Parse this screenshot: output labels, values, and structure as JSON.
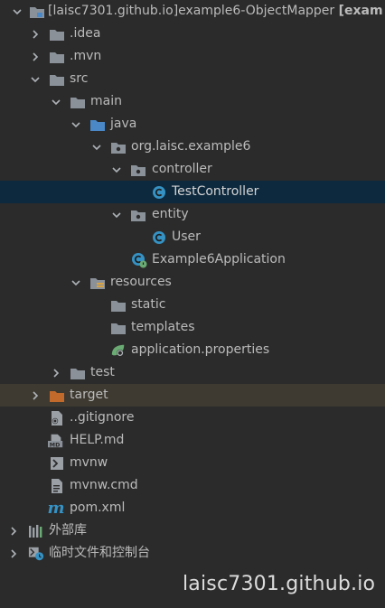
{
  "tree": {
    "root": {
      "label_prefix": "[laisc7301.github.io]example6-ObjectMapper ",
      "label_bold": "[exam"
    },
    "idea": "idea",
    "mvn": "mvn",
    "src": "src",
    "main": "main",
    "java": "java",
    "package": "org.laisc.example6",
    "controller": "controller",
    "test_controller": "TestController",
    "entity": "entity",
    "user": "User",
    "app": "Example6Application",
    "resources": "resources",
    "static": "static",
    "templates": "templates",
    "app_props": "application.properties",
    "test": "test",
    "target": "target",
    "gitignore": ".gitignore",
    "help_md": "HELP.md",
    "mvnw": "mvnw",
    "mvnw_cmd": "mvnw.cmd",
    "pom": "pom.xml",
    "external_libs": "外部库",
    "scratches": "临时文件和控制台"
  },
  "watermark": "laisc7301.github.io",
  "colors": {
    "background": "#2b2b2b",
    "selected_row": "#0d293e",
    "excluded_row": "#3e3a31",
    "folder": "#8a9199",
    "source_folder": "#4a88c7",
    "excluded_folder": "#c26a2b",
    "class_icon": "#3592c4",
    "text": "#bbbbbb"
  },
  "icons": {
    "module": "module-folder-icon",
    "folder": "folder-icon",
    "source_root": "source-root-folder-icon",
    "package": "package-icon",
    "class": "java-class-icon",
    "spring_app": "spring-boot-application-icon",
    "resources_root": "resources-root-folder-icon",
    "properties": "spring-properties-icon",
    "excluded": "excluded-folder-icon",
    "gitignore": "ignore-file-icon",
    "markdown": "markdown-file-icon",
    "shell": "shell-script-icon",
    "text_file": "text-file-icon",
    "maven": "maven-pom-icon",
    "libraries": "external-libraries-icon",
    "scratches": "scratches-consoles-icon"
  }
}
